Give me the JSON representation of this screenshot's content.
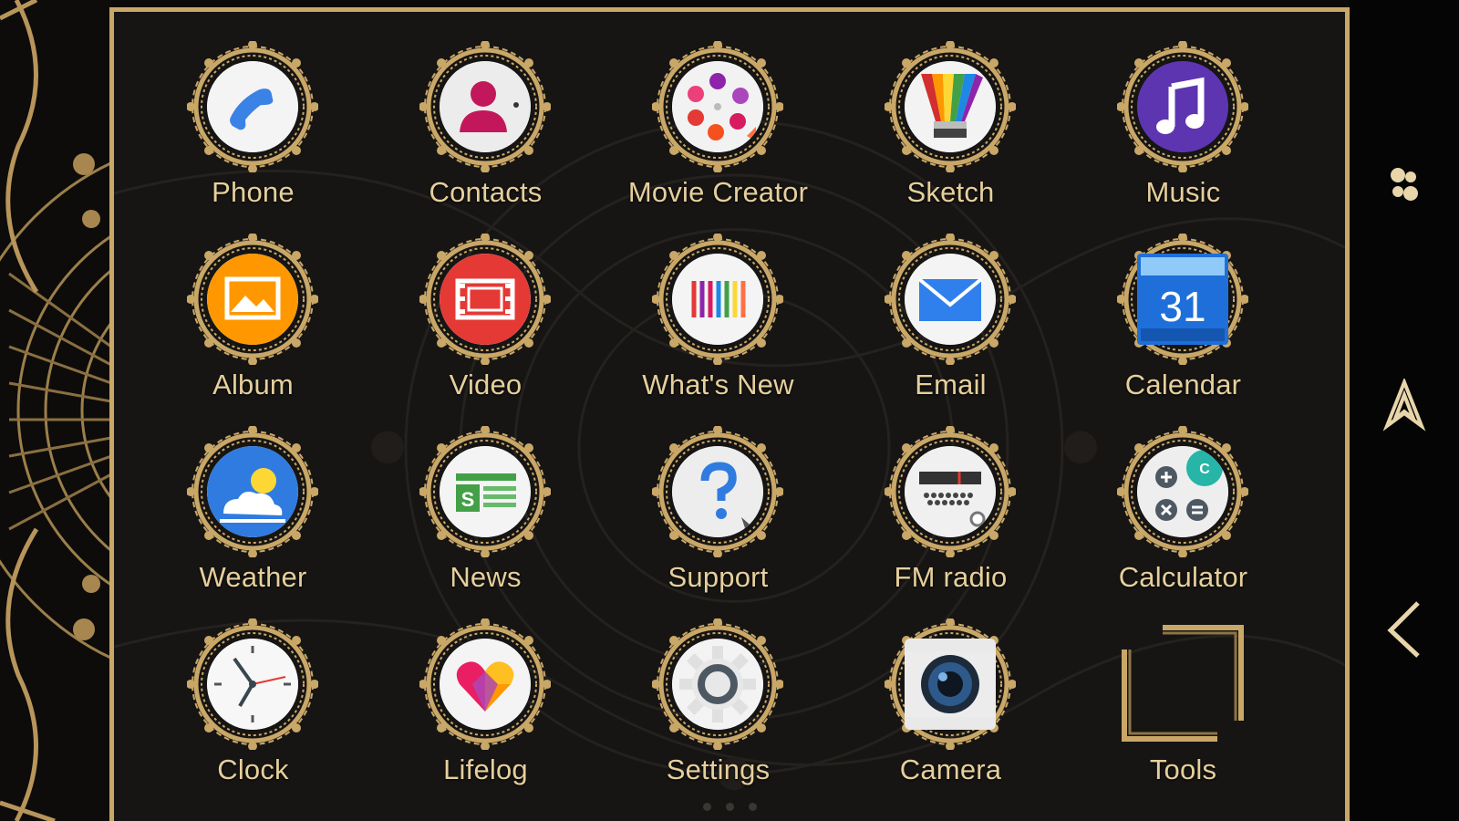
{
  "colors": {
    "gold": "#c9a767",
    "label": "#e6cf9b",
    "background": "#161514"
  },
  "apps": [
    {
      "name": "Phone",
      "icon": "phone-icon"
    },
    {
      "name": "Contacts",
      "icon": "contacts-icon"
    },
    {
      "name": "Movie Creator",
      "icon": "movie-creator-icon"
    },
    {
      "name": "Sketch",
      "icon": "sketch-icon"
    },
    {
      "name": "Music",
      "icon": "music-icon"
    },
    {
      "name": "Album",
      "icon": "album-icon"
    },
    {
      "name": "Video",
      "icon": "video-icon"
    },
    {
      "name": "What's New",
      "icon": "whats-new-icon"
    },
    {
      "name": "Email",
      "icon": "email-icon"
    },
    {
      "name": "Calendar",
      "icon": "calendar-icon",
      "day": "31"
    },
    {
      "name": "Weather",
      "icon": "weather-icon"
    },
    {
      "name": "News",
      "icon": "news-icon"
    },
    {
      "name": "Support",
      "icon": "support-icon"
    },
    {
      "name": "FM radio",
      "icon": "fm-radio-icon"
    },
    {
      "name": "Calculator",
      "icon": "calculator-icon"
    },
    {
      "name": "Clock",
      "icon": "clock-icon"
    },
    {
      "name": "Lifelog",
      "icon": "lifelog-icon"
    },
    {
      "name": "Settings",
      "icon": "settings-icon"
    },
    {
      "name": "Camera",
      "icon": "camera-icon"
    },
    {
      "name": "Tools",
      "icon": "folder-icon"
    }
  ],
  "navigation": [
    {
      "icon": "recent-apps-icon"
    },
    {
      "icon": "home-icon"
    },
    {
      "icon": "back-icon"
    }
  ]
}
